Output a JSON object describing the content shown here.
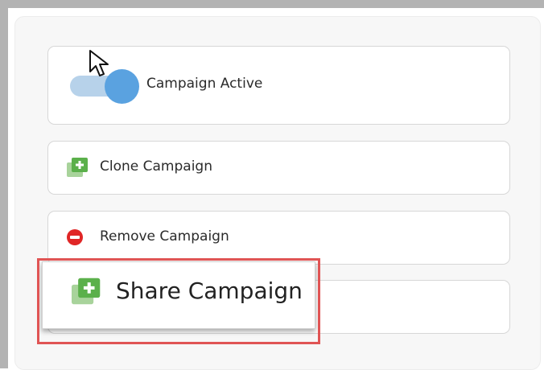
{
  "campaign_active": {
    "label": "Campaign Active",
    "enabled": true,
    "accent": "#5aa2e0"
  },
  "actions": {
    "clone_label": "Clone Campaign",
    "remove_label": "Remove Campaign",
    "share_label": "Share Campaign"
  },
  "icons": {
    "clone": "copy-plus-icon",
    "remove": "minus-circle-icon",
    "share": "copy-plus-icon",
    "cursor": "mouse-pointer-icon"
  },
  "colors": {
    "icon_green": "#5bb04b",
    "remove_red": "#e02626",
    "highlight_red": "#e05454"
  }
}
